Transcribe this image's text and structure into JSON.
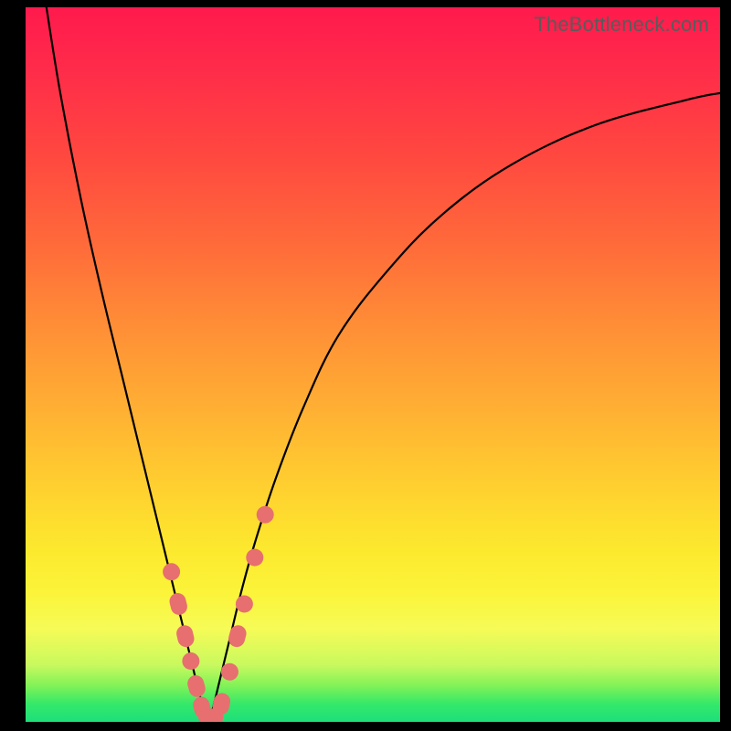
{
  "watermark": "TheBottleneck.com",
  "colors": {
    "frame": "#000000",
    "curve": "#000000",
    "marker": "#e76f6f",
    "gradient_stops": [
      "#ff1a4d",
      "#ff2a4a",
      "#ff4640",
      "#ff6a3a",
      "#ff8f36",
      "#ffb233",
      "#ffd22f",
      "#fce92e",
      "#fbf43a",
      "#f6fb57",
      "#c9f95e",
      "#7ff257",
      "#35e86a",
      "#1ddf7a"
    ]
  },
  "chart_data": {
    "type": "line",
    "title": "",
    "xlabel": "",
    "ylabel": "",
    "xlim": [
      0,
      100
    ],
    "ylim": [
      0,
      100
    ],
    "grid": false,
    "legend": false,
    "series": [
      {
        "name": "left-branch",
        "x": [
          3,
          5,
          8,
          11,
          14,
          16,
          18,
          20,
          21.5,
          23,
          24,
          25,
          25.8,
          26.4
        ],
        "y": [
          100,
          88,
          73,
          60,
          48,
          40,
          32,
          24,
          18,
          12,
          8,
          4,
          1.5,
          0
        ]
      },
      {
        "name": "right-branch",
        "x": [
          26.4,
          27,
          28,
          29.5,
          31,
          33,
          36,
          40,
          45,
          52,
          60,
          70,
          82,
          95,
          100
        ],
        "y": [
          0,
          2,
          6,
          12,
          18,
          25,
          34,
          44,
          54,
          63,
          71,
          78,
          83.5,
          87,
          88
        ]
      }
    ],
    "markers": {
      "comment": "salmon dots/pills clustered near valley on both branches",
      "points": [
        {
          "branch": "left",
          "x": 21.0,
          "y": 21.0,
          "shape": "dot"
        },
        {
          "branch": "left",
          "x": 22.0,
          "y": 16.5,
          "shape": "pill"
        },
        {
          "branch": "left",
          "x": 23.0,
          "y": 12.0,
          "shape": "pill"
        },
        {
          "branch": "left",
          "x": 23.8,
          "y": 8.5,
          "shape": "dot"
        },
        {
          "branch": "left",
          "x": 24.6,
          "y": 5.0,
          "shape": "pill"
        },
        {
          "branch": "left",
          "x": 25.4,
          "y": 2.0,
          "shape": "pill"
        },
        {
          "branch": "left",
          "x": 26.2,
          "y": 0.3,
          "shape": "pill"
        },
        {
          "branch": "right",
          "x": 27.2,
          "y": 0.4,
          "shape": "pill"
        },
        {
          "branch": "right",
          "x": 28.2,
          "y": 2.5,
          "shape": "pill"
        },
        {
          "branch": "right",
          "x": 29.4,
          "y": 7.0,
          "shape": "dot"
        },
        {
          "branch": "right",
          "x": 30.5,
          "y": 12.0,
          "shape": "pill"
        },
        {
          "branch": "right",
          "x": 31.5,
          "y": 16.5,
          "shape": "dot"
        },
        {
          "branch": "right",
          "x": 33.0,
          "y": 23.0,
          "shape": "dot"
        },
        {
          "branch": "right",
          "x": 34.5,
          "y": 29.0,
          "shape": "dot"
        }
      ]
    }
  }
}
